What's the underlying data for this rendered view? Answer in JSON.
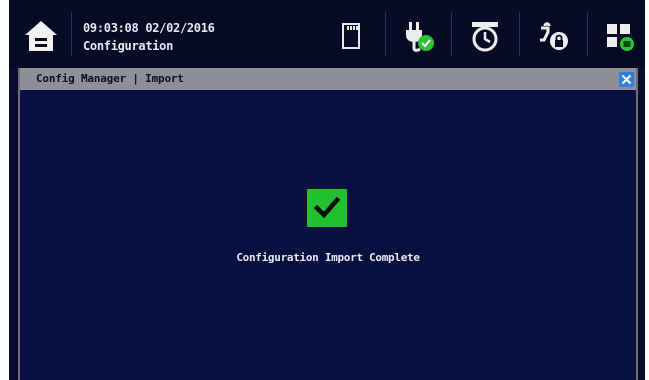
{
  "header": {
    "datetime": "09:03:08 02/02/2016",
    "mode": "Configuration",
    "icons": {
      "home": "home-icon",
      "sd_card": "sd-card-icon",
      "power": "power-plug-ok-icon",
      "alarm_clock": "alarm-clock-icon",
      "user_lock": "user-lock-icon",
      "layout": "layout-grid-icon"
    },
    "status_ok_color": "#2bc23a"
  },
  "window": {
    "title": "Config Manager | Import",
    "close_icon": "close-icon",
    "status_icon": "checkmark-icon",
    "message": "Configuration Import Complete",
    "accent_color": "#21c02c"
  }
}
